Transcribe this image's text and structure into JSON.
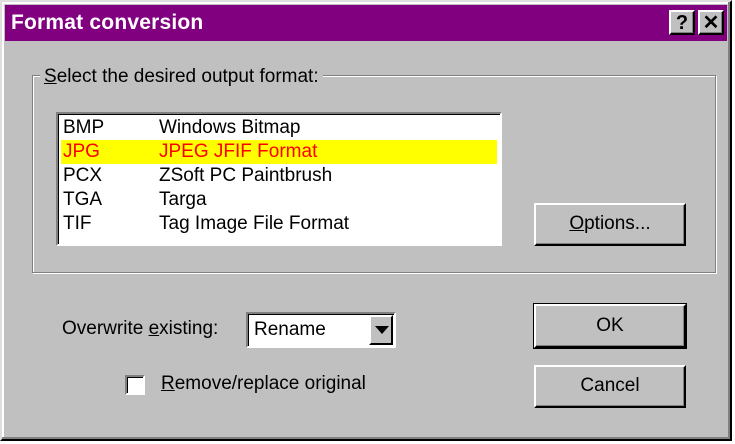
{
  "window": {
    "title": "Format conversion"
  },
  "titlebar": {
    "help_glyph": "?",
    "close_glyph": "✕"
  },
  "group": {
    "label_u": "S",
    "label_rest": "elect the desired output format:"
  },
  "formats": [
    {
      "code": "BMP",
      "desc": "Windows Bitmap",
      "selected": false
    },
    {
      "code": "JPG",
      "desc": "JPEG JFIF Format",
      "selected": true
    },
    {
      "code": "PCX",
      "desc": "ZSoft PC Paintbrush",
      "selected": false
    },
    {
      "code": "TGA",
      "desc": "Targa",
      "selected": false
    },
    {
      "code": "TIF",
      "desc": "Tag Image File Format",
      "selected": false
    }
  ],
  "buttons": {
    "options_u": "O",
    "options_rest": "ptions...",
    "ok": "OK",
    "cancel": "Cancel"
  },
  "overwrite": {
    "label_pre": "Overwrite ",
    "label_u": "e",
    "label_post": "xisting:",
    "value": "Rename"
  },
  "remove": {
    "label_u": "R",
    "label_rest": "emove/replace original",
    "checked": false
  },
  "colors": {
    "titlebar": "#800080",
    "selection_bg": "#ffff00",
    "selection_text": "#ff0000",
    "face": "#c0c0c0"
  },
  "icons": {
    "dropdown": "chevron-down-icon",
    "help": "help-icon",
    "close": "close-icon"
  }
}
